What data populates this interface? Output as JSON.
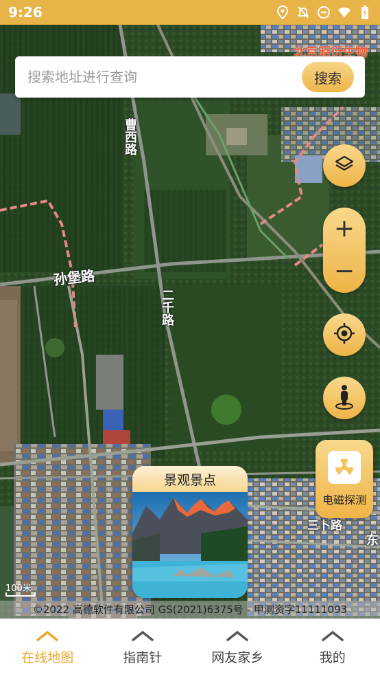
{
  "status_bar": {
    "time": "9:26",
    "icons": [
      "location-icon",
      "bell-off-icon",
      "do-not-disturb-icon",
      "wifi-icon",
      "battery-charging-icon"
    ]
  },
  "search": {
    "placeholder": "搜索地址进行查询",
    "button_label": "搜索"
  },
  "map": {
    "brand_overlay": "北京昭衍生物",
    "road_labels": {
      "caoxi": "曹西路",
      "sunbao": "孙堡路",
      "erqian": "二千路",
      "sanbu": "三卜路",
      "dong": "东"
    },
    "scale_label": "100米",
    "copyright": "©2022 高德软件有限公司 GS(2021)6375号 - 甲测资字11111093"
  },
  "controls": {
    "layers_icon": "layers-icon",
    "zoom_in": "+",
    "zoom_out": "−",
    "locate_icon": "locate-icon",
    "streetview_icon": "person-icon",
    "emf_label": "电磁探测",
    "emf_icon": "radiation-icon"
  },
  "scenic": {
    "title": "景观景点"
  },
  "tabs": [
    {
      "label": "在线地图",
      "active": true
    },
    {
      "label": "指南针",
      "active": false
    },
    {
      "label": "网友家乡",
      "active": false
    },
    {
      "label": "我的",
      "active": false
    }
  ],
  "colors": {
    "accent": "#e9b447",
    "active_tab": "#e9a62a"
  }
}
